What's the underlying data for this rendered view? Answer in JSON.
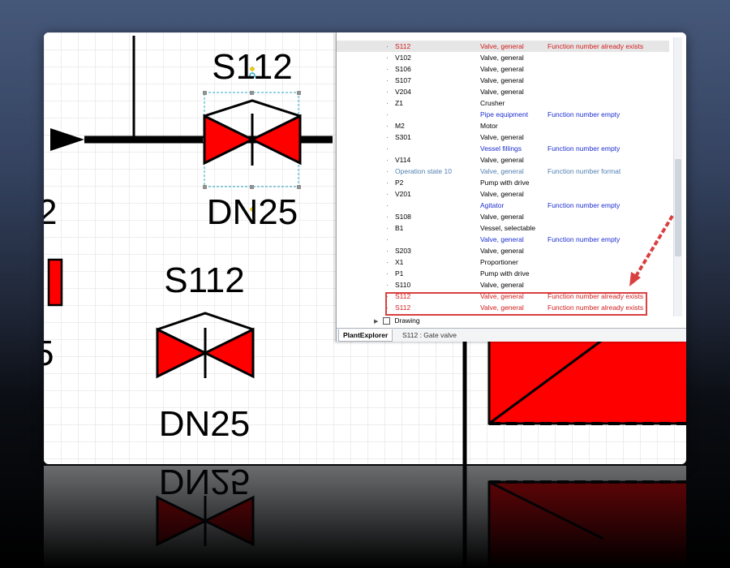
{
  "drawing": {
    "top_valve": {
      "tag": "S112",
      "size": "DN25"
    },
    "lower_valve": {
      "tag": "S112",
      "size": "DN25"
    },
    "cut_tag_left": "2",
    "cut_size_left": "5"
  },
  "explorer": {
    "rows": [
      {
        "tag": "S112",
        "desc": "Valve, general",
        "status": "Function number already exists",
        "style": "red",
        "selected": true
      },
      {
        "tag": "V102",
        "desc": "Valve, general",
        "status": "",
        "style": "normal"
      },
      {
        "tag": "S106",
        "desc": "Valve, general",
        "status": "",
        "style": "normal"
      },
      {
        "tag": "S107",
        "desc": "Valve, general",
        "status": "",
        "style": "normal"
      },
      {
        "tag": "V204",
        "desc": "Valve, general",
        "status": "",
        "style": "normal"
      },
      {
        "tag": "Z1",
        "desc": "Crusher",
        "status": "",
        "style": "normal"
      },
      {
        "tag": "",
        "desc": "Pipe equipment",
        "status": "Function number empty",
        "style": "blue"
      },
      {
        "tag": "M2",
        "desc": "Motor",
        "status": "",
        "style": "normal"
      },
      {
        "tag": "S301",
        "desc": "Valve, general",
        "status": "",
        "style": "normal"
      },
      {
        "tag": "",
        "desc": "Vessel fillings",
        "status": "Function number empty",
        "style": "blue"
      },
      {
        "tag": "V114",
        "desc": "Valve, general",
        "status": "",
        "style": "normal"
      },
      {
        "tag": "Operation state 10",
        "desc": "Valve, general",
        "status": "Function number format",
        "style": "steel"
      },
      {
        "tag": "P2",
        "desc": "Pump with drive",
        "status": "",
        "style": "normal"
      },
      {
        "tag": "V201",
        "desc": "Valve, general",
        "status": "",
        "style": "normal"
      },
      {
        "tag": "",
        "desc": "Agitator",
        "status": "Function number empty",
        "style": "blue"
      },
      {
        "tag": "S108",
        "desc": "Valve, general",
        "status": "",
        "style": "normal"
      },
      {
        "tag": "B1",
        "desc": "Vessel, selectable",
        "status": "",
        "style": "normal"
      },
      {
        "tag": "",
        "desc": "Valve, general",
        "status": "Function number empty",
        "style": "blue"
      },
      {
        "tag": "S203",
        "desc": "Valve, general",
        "status": "",
        "style": "normal"
      },
      {
        "tag": "X1",
        "desc": "Proportioner",
        "status": "",
        "style": "normal"
      },
      {
        "tag": "P1",
        "desc": "Pump with drive",
        "status": "",
        "style": "normal"
      },
      {
        "tag": "S110",
        "desc": "Valve, general",
        "status": "",
        "style": "normal"
      },
      {
        "tag": "S112",
        "desc": "Valve, general",
        "status": "Function number already exists",
        "style": "red"
      },
      {
        "tag": "S112",
        "desc": "Valve, general",
        "status": "Function number already exists",
        "style": "red"
      }
    ],
    "drawing_node": "Drawing",
    "tabs": [
      "PlantExplorer",
      "S112 : Gate valve"
    ]
  },
  "colors": {
    "valve_fill": "#ff0000",
    "error_text": "#d21c1c",
    "empty_text": "#1d2ed0",
    "format_text": "#4e7fb0",
    "highlight": "#d94040",
    "selection_handle": "#2aa7c9"
  }
}
